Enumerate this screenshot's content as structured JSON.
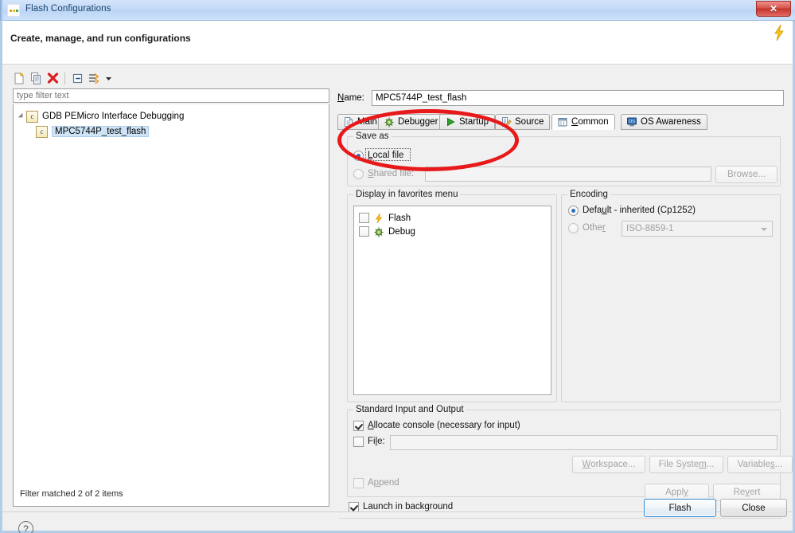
{
  "window": {
    "title": "Flash Configurations",
    "close_label": "✕",
    "icon": "flash-config-icon"
  },
  "header": {
    "title": "Create, manage, and run configurations",
    "decoration_icon": "lightning-bolt-icon"
  },
  "left_panel": {
    "toolbar": [
      {
        "name": "new-launch-configuration-icon",
        "title": "New launch configuration"
      },
      {
        "name": "duplicate-configuration-icon",
        "title": "Duplicate"
      },
      {
        "name": "delete-configuration-icon",
        "title": "Delete"
      },
      {
        "name": "collapse-all-icon",
        "title": "Collapse All"
      },
      {
        "name": "filter-launch-configurations-icon",
        "title": "Filter"
      },
      {
        "name": "view-menu-chevron-icon",
        "title": "View Menu"
      }
    ],
    "filter": {
      "value": "",
      "placeholder": "type filter text"
    },
    "tree": [
      {
        "label": "GDB PEMicro Interface Debugging",
        "level": 0,
        "expanded": true,
        "selected": false
      },
      {
        "label": "MPC5744P_test_flash",
        "level": 1,
        "expanded": false,
        "selected": true
      }
    ],
    "status": "Filter matched 2 of 2 items"
  },
  "right_panel": {
    "name_label": "Name:",
    "name_value": "MPC5744P_test_flash",
    "tabs": [
      {
        "label": "Main",
        "icon": "document-icon",
        "selected": false
      },
      {
        "label": "Debugger",
        "icon": "bug-icon",
        "selected": false
      },
      {
        "label": "Startup",
        "icon": "play-icon",
        "selected": false
      },
      {
        "label": "Source",
        "icon": "source-edit-icon",
        "selected": false
      },
      {
        "label": "Common",
        "icon": "common-window-icon",
        "selected": true
      },
      {
        "label": "OS Awareness",
        "icon": "os-monitor-icon",
        "selected": false
      }
    ],
    "save_as": {
      "title": "Save as",
      "local_file_label": "Local file",
      "local_file_selected": true,
      "shared_file_label": "Shared file:",
      "shared_file_selected": false,
      "shared_file_value": "",
      "browse_label": "Browse..."
    },
    "favorites": {
      "title": "Display in favorites menu",
      "items": [
        {
          "label": "Flash",
          "icon": "lightning-bolt-icon",
          "checked": false
        },
        {
          "label": "Debug",
          "icon": "bug-icon",
          "checked": false
        }
      ]
    },
    "encoding": {
      "title": "Encoding",
      "default_label": "Default - inherited (Cp1252)",
      "default_selected": true,
      "other_label": "Other",
      "other_selected": false,
      "other_value": "ISO-8859-1"
    },
    "stdio": {
      "title": "Standard Input and Output",
      "allocate_console_label": "Allocate console (necessary for input)",
      "allocate_console_checked": true,
      "file_label": "File:",
      "file_checked": false,
      "file_value": "",
      "workspace_label": "Workspace...",
      "file_system_label": "File System...",
      "variables_label": "Variables...",
      "append_label": "Append",
      "append_checked": false
    },
    "launch_in_background": {
      "label": "Launch in background",
      "checked": true
    },
    "apply_label": "Apply",
    "revert_label": "Revert"
  },
  "footer": {
    "help_icon": "question-mark-icon",
    "flash_label": "Flash",
    "close_label": "Close"
  },
  "colors": {
    "titlebar": "#bcd7f5",
    "accent_blue": "#2a70b8",
    "annotation_red": "#e8191b",
    "close_red": "#c3342c",
    "status_text": "#2a2a2a"
  }
}
